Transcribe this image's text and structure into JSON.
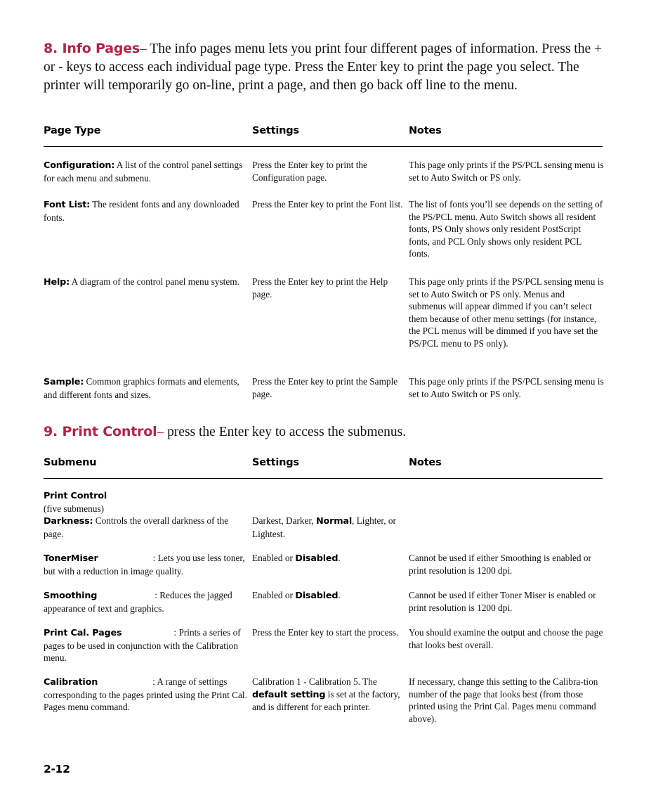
{
  "colors": {
    "heading_accent": "#B32346",
    "body_text": "#111111",
    "rule": "#000000"
  },
  "sections": {
    "info_pages": {
      "number": "8. Info Pages",
      "dash": "–",
      "intro": " The info pages menu lets you print four different pages of information. Press the + or - keys to access each individual page type. Press the Enter key to print the page you select. The printer will temporarily go on-line, print a page, and then go back off line to the menu."
    },
    "print_control": {
      "number": "9. Print Control",
      "dash": "–",
      "intro": " press the Enter key to access the submenus."
    }
  },
  "table_info_pages": {
    "headers": {
      "col1": "Page Type",
      "col2": "Settings",
      "col3": "Notes"
    },
    "rows": [
      {
        "term": "Configuration:",
        "desc": " A list of the control panel settings for each menu and submenu.",
        "settings": "Press the Enter key to print the Configuration page.",
        "notes": "This page only prints if the PS/PCL sensing menu is set to Auto Switch or PS only."
      },
      {
        "term": "Font List:",
        "desc": " The resident fonts and any downloaded fonts.",
        "settings": "Press the Enter key to print the Font list.",
        "notes": "The list of fonts you’ll see depends on the setting of the PS/PCL menu. Auto Switch shows all resident fonts, PS Only shows only resident PostScript fonts, and PCL Only shows only resident PCL fonts."
      },
      {
        "term": "Help:",
        "desc": " A diagram of the control panel menu system.",
        "settings": "Press the Enter key to print the Help page.",
        "notes": "This page only prints if the PS/PCL sensing menu is set to Auto Switch or PS only. Menus and submenus will appear dimmed if you can’t select them because of other menu settings (for instance, the PCL menus will be dimmed if you have set the PS/PCL menu to PS only)."
      },
      {
        "term": "Sample:",
        "desc": " Common graphics formats and elements, and different fonts and sizes.",
        "settings": "Press the Enter key to print the Sample page.",
        "notes": "This page only prints if the PS/PCL sensing menu is set to Auto Switch or PS only."
      }
    ]
  },
  "table_print_control": {
    "headers": {
      "col1": "Submenu",
      "col2": "Settings",
      "col3": "Notes"
    },
    "group_heading": {
      "title": "Print Control",
      "subtitle": "(five submenus)"
    },
    "rows": [
      {
        "term": "Darkness:",
        "desc": " Controls the overall darkness of the page.",
        "settings_pre": "Darkest, Darker, ",
        "settings_bold": "Normal",
        "settings_post": ", Lighter, or Lightest.",
        "notes": ""
      },
      {
        "term": "TonerMiser",
        "desc_colon": ": Lets you use less toner, but with a reduction in image quality.",
        "settings_pre": "Enabled or ",
        "settings_bold": "Disabled",
        "settings_post": ".",
        "notes": "Cannot be used if either Smoothing is enabled or print resolution is 1200 dpi."
      },
      {
        "term": "Smoothing",
        "desc_colon": ": Reduces the jagged appearance of text and graphics.",
        "settings_pre": "Enabled or ",
        "settings_bold": "Disabled",
        "settings_post": ".",
        "notes": "Cannot be used if either Toner Miser is enabled or print resolution is 1200 dpi."
      },
      {
        "term": "Print Cal. Pages",
        "desc_colon": ": Prints a series of pages to be used in conjunction with the Calibration menu.",
        "settings_plain": "Press the Enter key to start the process.",
        "notes": "You should examine the output and choose the page that looks best overall."
      },
      {
        "term": "Calibration",
        "desc_colon": ": A range of settings corresponding to the pages printed using the Print Cal. Pages menu command.",
        "settings_pre": "Calibration 1 - Calibration 5. The ",
        "settings_bold": "default setting",
        "settings_post": " is set at the factory, and is different for each printer.",
        "notes": "If necessary, change this setting to the Calibra-tion number of the page that looks best (from those printed using the Print Cal. Pages menu command above)."
      }
    ]
  },
  "footer": {
    "page_number": "2-12"
  }
}
